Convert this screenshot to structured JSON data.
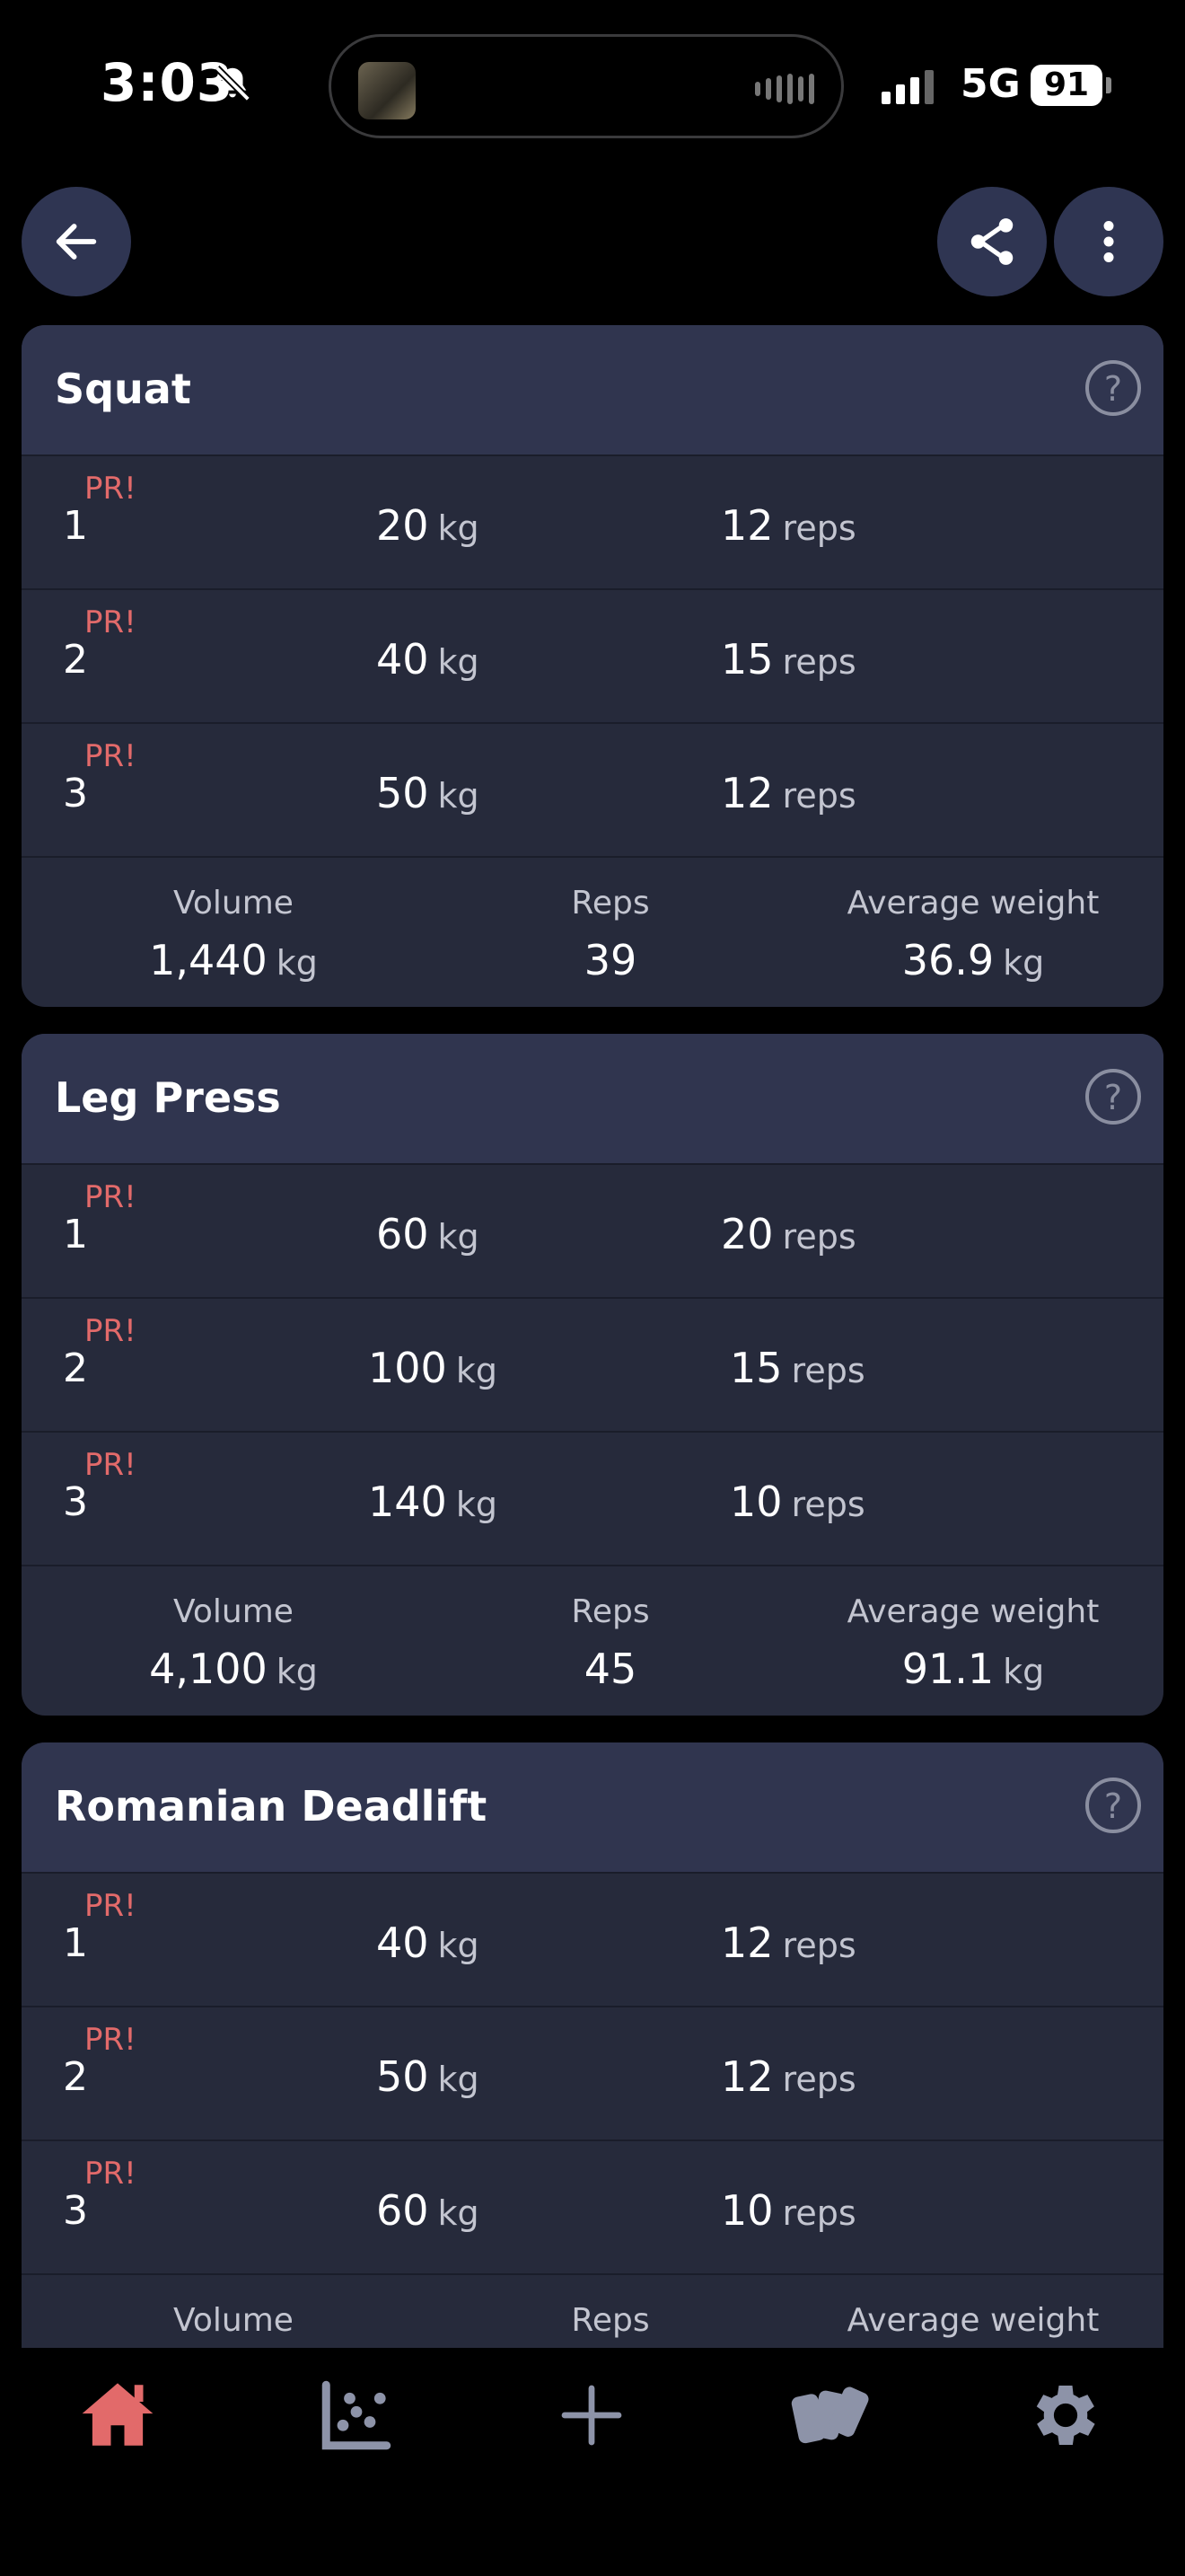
{
  "status_bar": {
    "time": "3:03",
    "network": "5G",
    "battery": "91"
  },
  "nav": {
    "back_icon": "arrow-left-icon",
    "share_icon": "share-icon",
    "more_icon": "more-vertical-icon"
  },
  "colors": {
    "background": "#000000",
    "card": "#262a3b",
    "card_header": "#30354f",
    "pr": "#e26a6a",
    "accent": "#e26a6a",
    "nav_inactive": "#8d93a8"
  },
  "exercises": [
    {
      "name": "Squat",
      "sets": [
        {
          "num": "1",
          "badge": "PR!",
          "weight": "20",
          "weight_unit": "kg",
          "reps": "12",
          "reps_unit": "reps"
        },
        {
          "num": "2",
          "badge": "PR!",
          "weight": "40",
          "weight_unit": "kg",
          "reps": "15",
          "reps_unit": "reps"
        },
        {
          "num": "3",
          "badge": "PR!",
          "weight": "50",
          "weight_unit": "kg",
          "reps": "12",
          "reps_unit": "reps"
        }
      ],
      "summary": {
        "volume_label": "Volume",
        "volume": "1,440",
        "volume_unit": "kg",
        "reps_label": "Reps",
        "reps": "39",
        "avg_label": "Average weight",
        "avg": "36.9",
        "avg_unit": "kg"
      }
    },
    {
      "name": "Leg Press",
      "sets": [
        {
          "num": "1",
          "badge": "PR!",
          "weight": "60",
          "weight_unit": "kg",
          "reps": "20",
          "reps_unit": "reps"
        },
        {
          "num": "2",
          "badge": "PR!",
          "weight": "100",
          "weight_unit": "kg",
          "reps": "15",
          "reps_unit": "reps"
        },
        {
          "num": "3",
          "badge": "PR!",
          "weight": "140",
          "weight_unit": "kg",
          "reps": "10",
          "reps_unit": "reps"
        }
      ],
      "summary": {
        "volume_label": "Volume",
        "volume": "4,100",
        "volume_unit": "kg",
        "reps_label": "Reps",
        "reps": "45",
        "avg_label": "Average weight",
        "avg": "91.1",
        "avg_unit": "kg"
      }
    },
    {
      "name": "Romanian Deadlift",
      "sets": [
        {
          "num": "1",
          "badge": "PR!",
          "weight": "40",
          "weight_unit": "kg",
          "reps": "12",
          "reps_unit": "reps"
        },
        {
          "num": "2",
          "badge": "PR!",
          "weight": "50",
          "weight_unit": "kg",
          "reps": "12",
          "reps_unit": "reps"
        },
        {
          "num": "3",
          "badge": "PR!",
          "weight": "60",
          "weight_unit": "kg",
          "reps": "10",
          "reps_unit": "reps"
        }
      ],
      "summary": {
        "volume_label": "Volume",
        "reps_label": "Reps",
        "avg_label": "Average weight"
      }
    }
  ],
  "bottom_nav": [
    {
      "icon": "home-icon",
      "active": true
    },
    {
      "icon": "chart-scatter-icon",
      "active": false
    },
    {
      "icon": "plus-icon",
      "active": false
    },
    {
      "icon": "stack-cards-icon",
      "active": false
    },
    {
      "icon": "gear-icon",
      "active": false
    }
  ]
}
